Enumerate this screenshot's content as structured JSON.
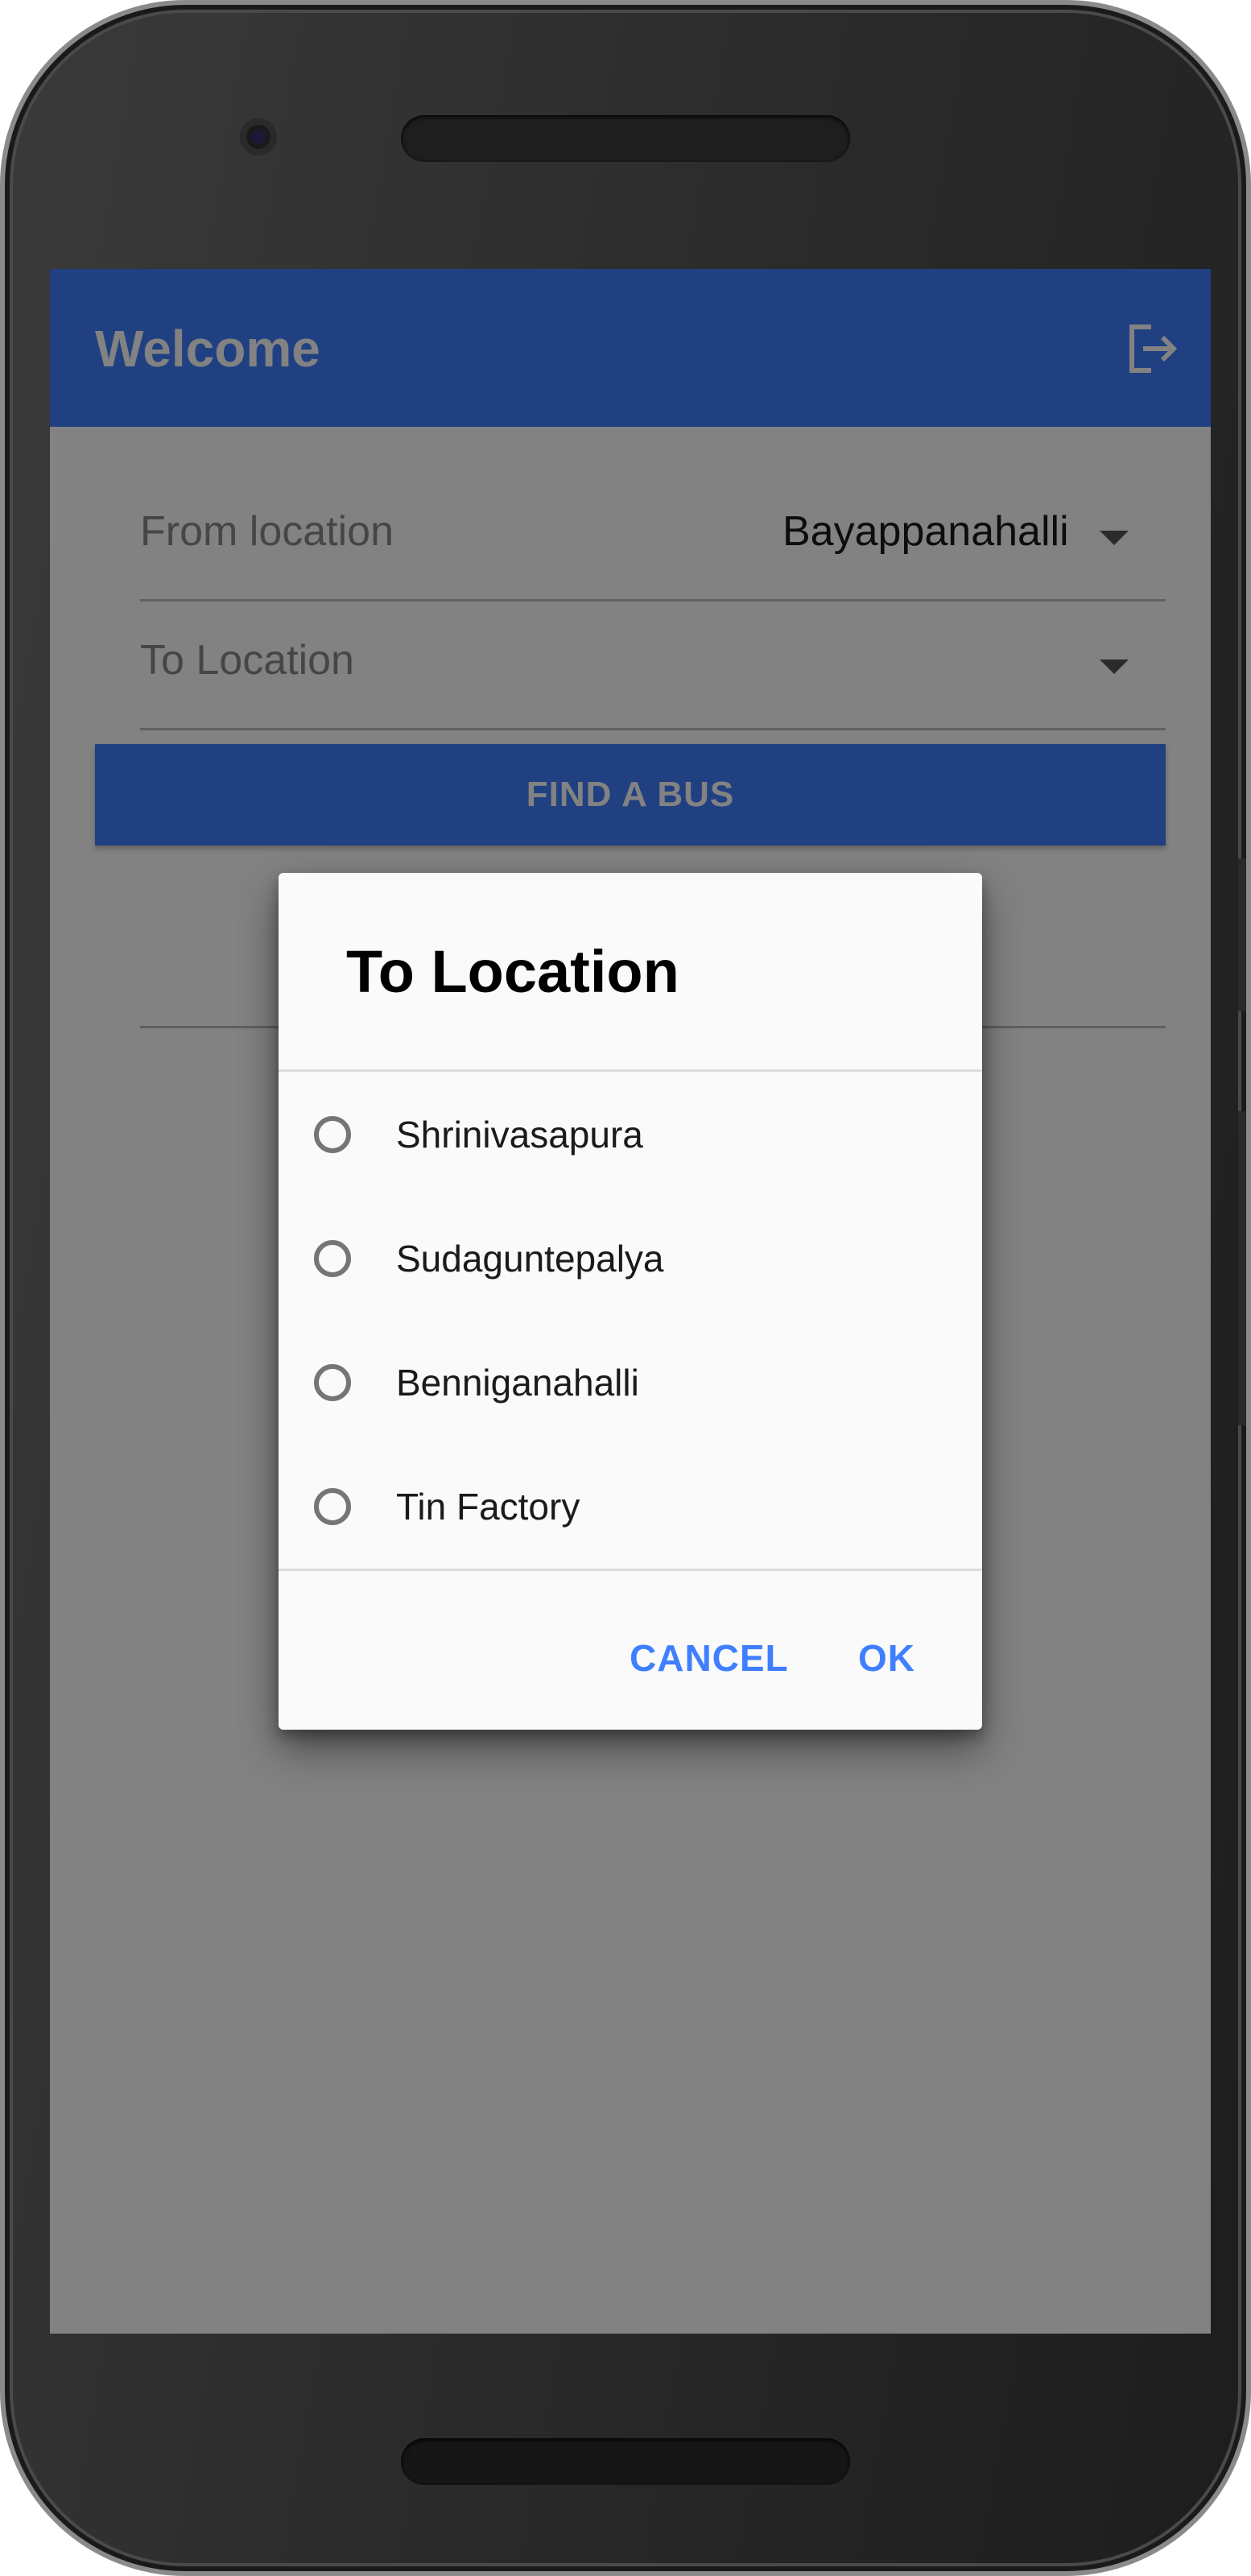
{
  "app": {
    "title": "Welcome",
    "accent_color": "#3f7fff"
  },
  "form": {
    "from_label": "From location",
    "from_value": "Bayappanahalli",
    "to_label": "To Location",
    "to_value": "",
    "find_button_label": "FIND A BUS"
  },
  "dialog": {
    "title": "To Location",
    "options": [
      {
        "label": "Shrinivasapura",
        "selected": false
      },
      {
        "label": "Sudaguntepalya",
        "selected": false
      },
      {
        "label": "Benniganahalli",
        "selected": false
      },
      {
        "label": "Tin Factory",
        "selected": false
      }
    ],
    "cancel_label": "CANCEL",
    "ok_label": "OK"
  },
  "icons": {
    "logout": "logout-icon",
    "dropdown": "dropdown-arrow-icon",
    "radio": "radio-unchecked-icon"
  }
}
